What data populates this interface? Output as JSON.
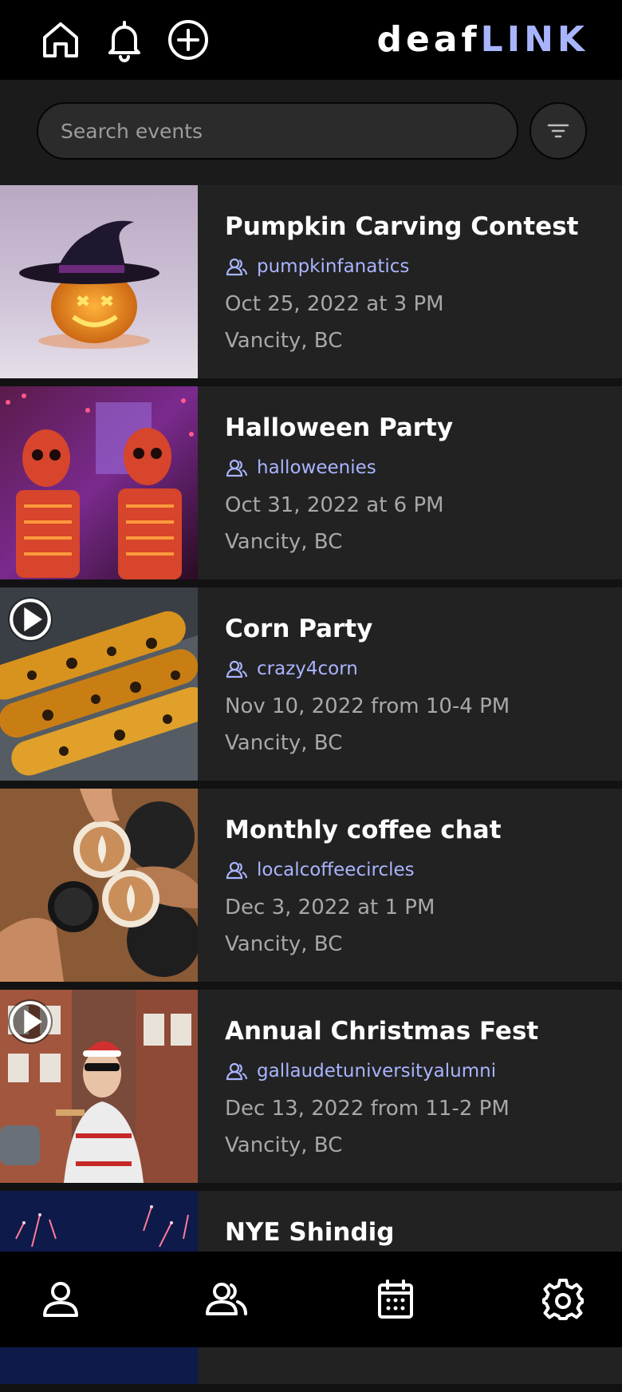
{
  "header": {
    "brand_part1": "deaf",
    "brand_part2": "LINK",
    "icons": [
      "home-icon",
      "bell-icon",
      "add-circle-icon"
    ]
  },
  "search": {
    "placeholder": "Search events",
    "filter_icon": "filter-icon"
  },
  "events": [
    {
      "title": "Pumpkin Carving Contest",
      "group": "pumpkinfanatics",
      "date": "Oct 25, 2022 at 3 PM",
      "location": "Vancity, BC",
      "has_video": false
    },
    {
      "title": "Halloween Party",
      "group": "halloweenies",
      "date": "Oct 31, 2022 at 6 PM",
      "location": "Vancity, BC",
      "has_video": false
    },
    {
      "title": "Corn Party",
      "group": "crazy4corn",
      "date": "Nov 10, 2022 from 10-4 PM",
      "location": "Vancity, BC",
      "has_video": true
    },
    {
      "title": "Monthly coffee chat",
      "group": "localcoffeecircles",
      "date": "Dec 3, 2022 at 1 PM",
      "location": "Vancity, BC",
      "has_video": false
    },
    {
      "title": "Annual Christmas Fest",
      "group": "gallaudetuniversityalumni",
      "date": "Dec 13, 2022 from 11-2 PM",
      "location": "Vancity, BC",
      "has_video": true
    },
    {
      "title": "NYE Shindig",
      "group": "",
      "date": "",
      "location": "",
      "has_video": false
    }
  ],
  "bottom_nav": {
    "icons": [
      "profile-icon",
      "groups-icon",
      "calendar-icon",
      "settings-icon"
    ]
  },
  "colors": {
    "accent": "#a9b4ff",
    "background": "#121212",
    "card": "#222222",
    "bar": "#000000"
  }
}
